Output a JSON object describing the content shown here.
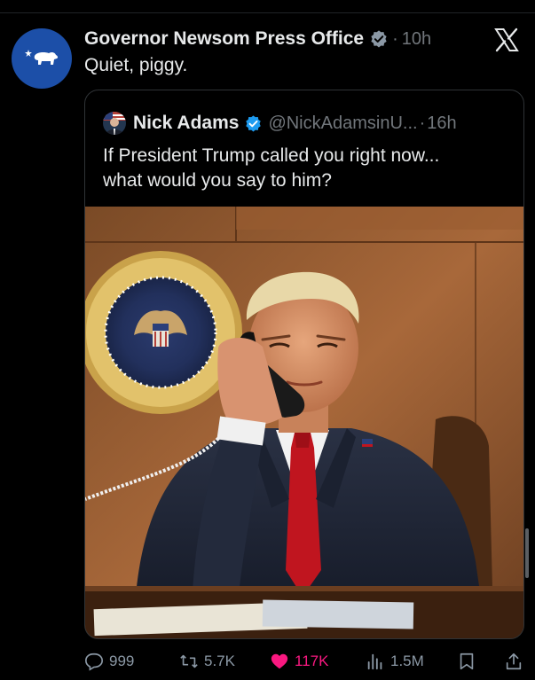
{
  "post": {
    "author_name": "Governor Newsom Press Office",
    "separator": "·",
    "time": "10h",
    "text": "Quiet, piggy.",
    "avatar_icon": "bear-icon",
    "verified_color": "#8b98a5",
    "platform_icon": "x-logo-icon"
  },
  "quote": {
    "author_name": "Nick Adams",
    "handle": "@NickAdamsinU...",
    "separator": "·",
    "time": "16h",
    "text_line1": "If President Trump called you right now...",
    "text_line2": "what would you say to him?",
    "verified_color": "#1d9bf0",
    "media_description_icon": "photo-icon"
  },
  "actions": {
    "replies": "999",
    "reposts": "5.7K",
    "likes": "117K",
    "views": "1.5M",
    "like_color": "#f91880"
  }
}
